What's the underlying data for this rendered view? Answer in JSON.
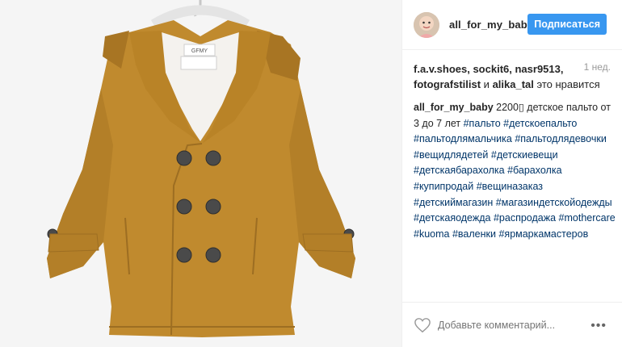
{
  "post": {
    "image_alt": "Children's mustard double-breasted coat on a hanger",
    "label_brand": "GFMY"
  },
  "header": {
    "username": "all_for_my_baby",
    "follow_label": "Подписаться"
  },
  "likes": {
    "users": "f.a.v.shoes, sockit6, nasr9513, fotografstilist",
    "conjunction": " и ",
    "last_user": "alika_tal",
    "suffix": " это нравится",
    "time": "1 нед."
  },
  "caption": {
    "user": "all_for_my_baby",
    "text": " 2200▯ детское пальто от 3 до 7 лет ",
    "hashtags": [
      "#пальто",
      "#детскоепальто",
      "#пальтодлямальчика",
      "#пальтодлядевочки",
      "#вещидлядетей",
      "#детскиевещи",
      "#детскаябарахолка",
      "#барахолка",
      "#купипродай",
      "#вещиназаказ",
      "#детскиймагазин",
      "#магазиндетскойодежды",
      "#детскаяодежда",
      "#распродажа",
      "#mothercare",
      "#kuoma",
      "#валенки",
      "#ярмаркамастеров"
    ]
  },
  "footer": {
    "comment_placeholder": "Добавьте комментарий...",
    "more_label": "•••"
  },
  "colors": {
    "coat": "#c08a2e",
    "follow_button": "#3897f0",
    "hashtag": "#003569"
  }
}
